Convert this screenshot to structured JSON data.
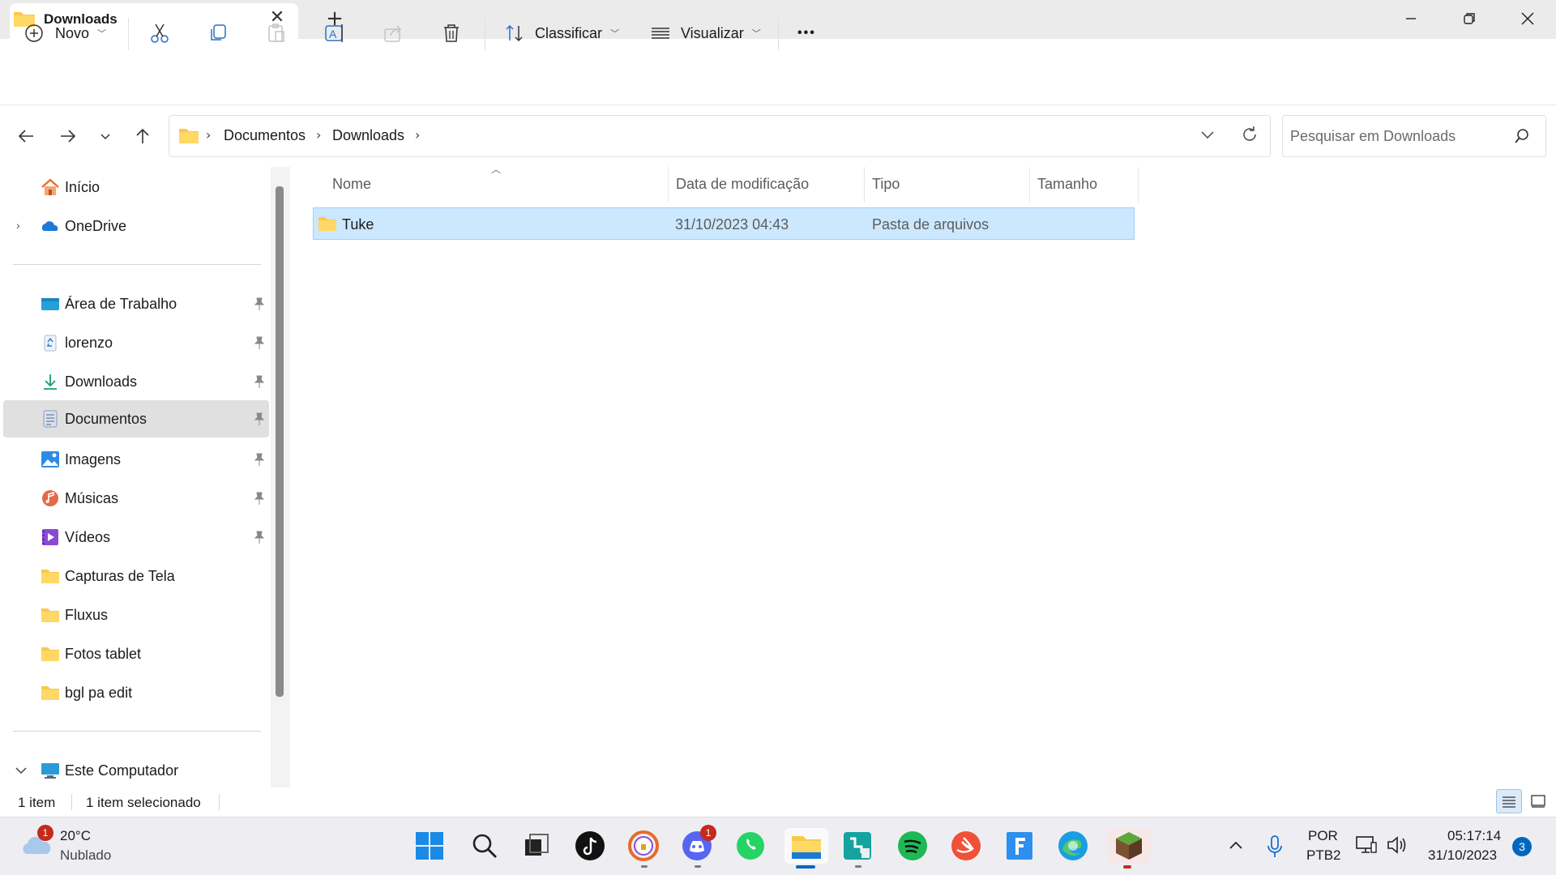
{
  "window": {
    "tab_title": "Downloads",
    "new_tab": "+",
    "close_tab": "✕"
  },
  "toolbar": {
    "new_label": "Novo",
    "sort_label": "Classificar",
    "view_label": "Visualizar",
    "more_label": "•••"
  },
  "breadcrumb": [
    "Documentos",
    "Downloads"
  ],
  "search": {
    "placeholder": "Pesquisar em Downloads"
  },
  "sidebar": {
    "top": [
      {
        "label": "Início",
        "icon": "home-icon"
      },
      {
        "label": "OneDrive",
        "icon": "onedrive-cloud-icon"
      }
    ],
    "quick": [
      {
        "label": "Área de Trabalho",
        "icon": "desktop-icon",
        "pinned": true
      },
      {
        "label": "lorenzo",
        "icon": "recycle-icon",
        "pinned": true
      },
      {
        "label": "Downloads",
        "icon": "download-icon",
        "pinned": true
      },
      {
        "label": "Documentos",
        "icon": "document-icon",
        "pinned": true
      },
      {
        "label": "Imagens",
        "icon": "pictures-icon",
        "pinned": true
      },
      {
        "label": "Músicas",
        "icon": "music-icon",
        "pinned": true
      },
      {
        "label": "Vídeos",
        "icon": "videos-icon",
        "pinned": true
      },
      {
        "label": "Capturas de Tela",
        "icon": "folder-icon",
        "pinned": false
      },
      {
        "label": "Fluxus",
        "icon": "folder-icon",
        "pinned": false
      },
      {
        "label": "Fotos tablet",
        "icon": "folder-icon",
        "pinned": false
      },
      {
        "label": "bgl pa edit",
        "icon": "folder-icon",
        "pinned": false
      }
    ],
    "computer": {
      "label": "Este Computador",
      "icon": "computer-icon"
    }
  },
  "columns": [
    "Nome",
    "Data de modificação",
    "Tipo",
    "Tamanho"
  ],
  "files": [
    {
      "name": "Tuke",
      "modified": "31/10/2023 04:43",
      "type": "Pasta de arquivos",
      "size": ""
    }
  ],
  "status": {
    "count": "1 item",
    "selected": "1 item selecionado"
  },
  "taskbar": {
    "weather_temp": "20°C",
    "weather_desc": "Nublado",
    "weather_badge": "1",
    "discord_badge": "1",
    "lang1": "POR",
    "lang2": "PTB2",
    "time": "05:17:14",
    "date": "31/10/2023",
    "notifications": "3"
  },
  "colors": {
    "selection": "#cce8ff",
    "accent": "#0067c0"
  }
}
